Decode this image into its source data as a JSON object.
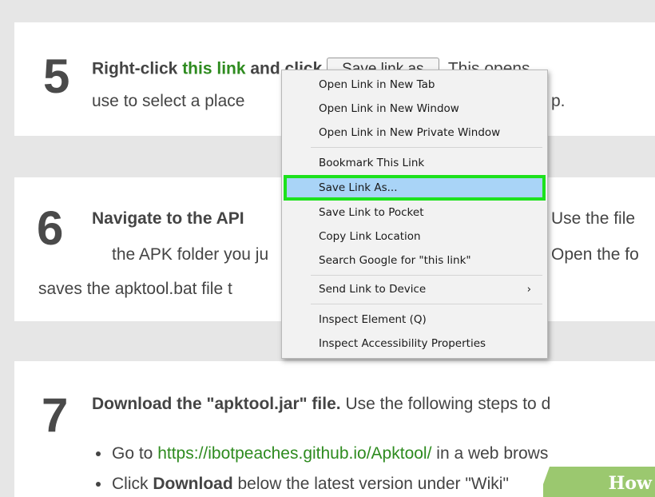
{
  "step5": {
    "number": "5",
    "line1_pre": "Right-click ",
    "line1_link": "this link",
    "line1_mid": " and click ",
    "save_button": "Save link as",
    "line1_post": ". This opens",
    "line2_pre": "use to select a place",
    "line2_post": "p."
  },
  "step6": {
    "number": "6",
    "line1_pre": "Navigate to the API",
    "line1_post": "Use the file",
    "line2_pre": "the APK folder you ju",
    "line2_post": "Open the fo",
    "line3_pre": "saves the apktool.bat file t"
  },
  "step7": {
    "number": "7",
    "title": "Download the \"apktool.jar\" file.",
    "title_post": " Use the following steps to d",
    "bullet1_pre": "Go to ",
    "bullet1_link": "https://ibotpeaches.github.io/Apktool/",
    "bullet1_post": " in a web brows",
    "bullet2_pre": "Click ",
    "bullet2_bold": "Download",
    "bullet2_post": " below the latest version under \"Wiki\""
  },
  "context_menu": {
    "items": [
      "Open Link in New Tab",
      "Open Link in New Window",
      "Open Link in New Private Window",
      "Bookmark This Link",
      "Save Link As...",
      "Save Link to Pocket",
      "Copy Link Location",
      "Search Google for \"this link\"",
      "Send Link to Device",
      "Inspect Element (Q)",
      "Inspect Accessibility Properties"
    ],
    "submenu_arrow": "›",
    "highlighted_item": "Save Link As..."
  },
  "watermark": {
    "text": "How"
  },
  "colors": {
    "accent_green": "#2e8b1f",
    "highlight_outline": "#1de21d",
    "menu_selected": "#a9d4f7"
  }
}
